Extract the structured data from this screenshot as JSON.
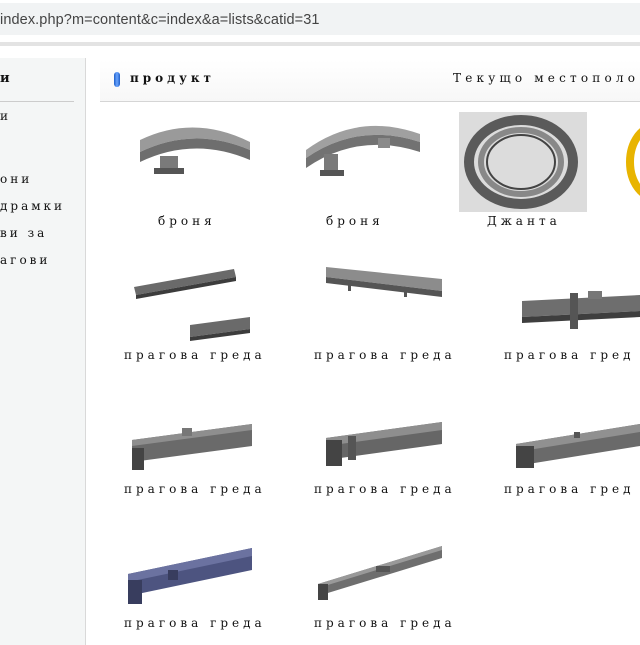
{
  "browser": {
    "address": "index.php?m=content&c=index&a=lists&catid=31"
  },
  "sidebar": {
    "title": "и",
    "items": [
      {
        "label": "и"
      },
      {
        "label": "они"
      },
      {
        "label": "драмки"
      },
      {
        "label": "ви за"
      },
      {
        "label": "агови"
      }
    ]
  },
  "header": {
    "title": "продукт",
    "location": "Текущо местополо"
  },
  "products": [
    {
      "caption": "броня",
      "icon": "armor-segment-image"
    },
    {
      "caption": "броня",
      "icon": "armor-segment-image"
    },
    {
      "caption": "Джанта",
      "icon": "rim-image"
    },
    {
      "caption": "",
      "icon": "gold-part-image"
    },
    {
      "caption": "прагова греда",
      "icon": "sill-beam-image"
    },
    {
      "caption": "прагова греда",
      "icon": "sill-beam-image"
    },
    {
      "caption": "прагова гред",
      "icon": "sill-beam-image"
    },
    {
      "caption": "прагова греда",
      "icon": "sill-beam-image"
    },
    {
      "caption": "прагова греда",
      "icon": "sill-beam-image"
    },
    {
      "caption": "прагова гред",
      "icon": "sill-beam-image"
    },
    {
      "caption": "прагова греда",
      "icon": "sill-beam-image"
    },
    {
      "caption": "прагова греда",
      "icon": "sill-beam-image"
    }
  ],
  "colors": {
    "accent_pill": "#2f6fd6",
    "steel": "#7d7d7d",
    "steel_dark": "#4a4a4a",
    "blue_steel": "#4d5480",
    "gold": "#e8b400"
  }
}
